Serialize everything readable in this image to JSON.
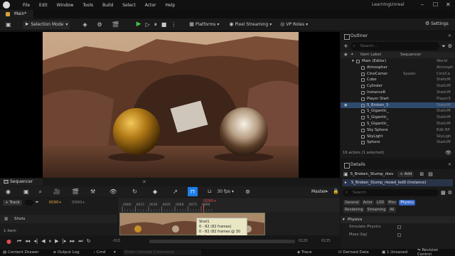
{
  "menu": [
    "File",
    "Edit",
    "Window",
    "Tools",
    "Build",
    "Select",
    "Actor",
    "Help"
  ],
  "project_name": "LearningUnreal",
  "level_tab": "Main*",
  "toolbar": {
    "mode": "Selection Mode",
    "platforms": "Platforms",
    "pixel_streaming": "Pixel Streaming",
    "vp_roles": "VP Roles",
    "settings": "Settings"
  },
  "outliner": {
    "title": "Outliner",
    "search_placeholder": "Search...",
    "col_label": "Item Label",
    "col_sequencer": "Sequencer",
    "items": [
      {
        "name": "Main (Editor)",
        "type": "World",
        "selected": false,
        "extra": ""
      },
      {
        "name": "Atmospher",
        "type": "Atmosph",
        "selected": false,
        "extra": ""
      },
      {
        "name": "CineCamer",
        "type": "CineCa",
        "selected": false,
        "extra": "Spawn"
      },
      {
        "name": "Cube",
        "type": "StaticM",
        "selected": false,
        "extra": ""
      },
      {
        "name": "Cylinder",
        "type": "StaticM",
        "selected": false,
        "extra": ""
      },
      {
        "name": "InstanceR",
        "type": "StaticM",
        "selected": false,
        "extra": ""
      },
      {
        "name": "Player Start",
        "type": "PlayerS",
        "selected": false,
        "extra": ""
      },
      {
        "name": "S_Broken_S",
        "type": "StaticM",
        "selected": true,
        "extra": ""
      },
      {
        "name": "S_Gigantic_",
        "type": "StaticM",
        "selected": false,
        "extra": ""
      },
      {
        "name": "S_Gigantic_",
        "type": "StaticM",
        "selected": false,
        "extra": ""
      },
      {
        "name": "S_Gigantic_",
        "type": "StaticM",
        "selected": false,
        "extra": ""
      },
      {
        "name": "Sky Sphere",
        "type": "Edit BP",
        "selected": false,
        "extra": ""
      },
      {
        "name": "SkyLight",
        "type": "SkyLigh",
        "selected": false,
        "extra": ""
      },
      {
        "name": "Sphere",
        "type": "StaticM",
        "selected": false,
        "extra": ""
      }
    ],
    "footer": "16 actors (1 selected)"
  },
  "details": {
    "title": "Details",
    "actor_name": "S_Broken_Stump_rkov",
    "add_label": "+ Add",
    "component": "S_Broken_Stump_rkowd_lod0 (Instance)",
    "search_placeholder": "Search",
    "chips_row1": [
      "General",
      "Actor",
      "LOD",
      "Misc",
      "Physics"
    ],
    "chips_row2": [
      "Rendering",
      "Streaming",
      "All"
    ],
    "section": "Physics",
    "prop1": "Simulate Physics",
    "prop2": "Mass (kg)"
  },
  "sequencer": {
    "tab": "Sequencer",
    "fps": "30 fps",
    "sequence_name": "Master",
    "track_btn": "+ Track",
    "search_placeholder": "Search Tracks",
    "timecode": "0090+",
    "timecode_right": "0090+",
    "track_name": "Shots",
    "item_count": "1 item",
    "tooltip_title": "Shot1",
    "tooltip_line1": "0 - 82 (82 frames)",
    "tooltip_line2": "0 - 82 (82 frames @ 30 fps)",
    "ruler_ticks": [
      "0000",
      "0015",
      "0030",
      "0045",
      "0060",
      "0075",
      "0090"
    ],
    "bottom_ticks": [
      "-015",
      "0120",
      "0135"
    ]
  },
  "status": {
    "content_drawer": "Content Drawer",
    "output_log": "Output Log",
    "cmd": "Cmd",
    "console_placeholder": "Enter Console Command",
    "trace": "Trace",
    "derived_data": "Derived Data",
    "unsaved": "1 Unsaved",
    "revision_control": "Revision Control"
  }
}
